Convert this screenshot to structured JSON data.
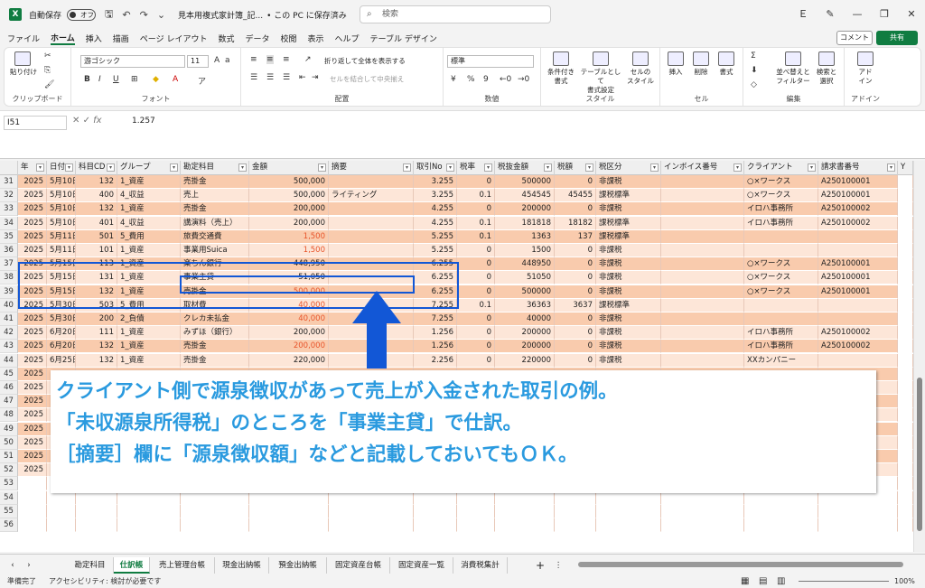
{
  "titlebar": {
    "autosave": "自動保存",
    "toggle": "オフ",
    "filename": "見本用複式家計簿_記...",
    "save_status": "• この PC に保存済み",
    "search_placeholder": "検索",
    "user_initial": "Ｅ"
  },
  "menu": {
    "tabs": [
      "ファイル",
      "ホーム",
      "挿入",
      "描画",
      "ページ レイアウト",
      "数式",
      "データ",
      "校閲",
      "表示",
      "ヘルプ",
      "テーブル デザイン"
    ],
    "active": "ホーム",
    "comment": "コメント",
    "share": "共有"
  },
  "ribbon": {
    "clipboard": {
      "label": "クリップボード",
      "paste": "貼り付け"
    },
    "font": {
      "label": "フォント",
      "name": "游ゴシック",
      "size": "11"
    },
    "align": {
      "label": "配置",
      "wrap": "折り返して全体を表示する",
      "merge": "セルを結合して中央揃え"
    },
    "number": {
      "label": "数値",
      "format": "標準"
    },
    "style": {
      "label": "スタイル",
      "cond": "条件付き\n書式",
      "table": "テーブルとして\n書式設定",
      "cellstyle": "セルの\nスタイル"
    },
    "cells": {
      "label": "セル",
      "insert": "挿入",
      "delete": "削除",
      "format": "書式"
    },
    "edit": {
      "label": "編集",
      "sort": "並べ替えと\nフィルター",
      "find": "検索と\n選択"
    },
    "addin": {
      "label": "アドイン",
      "btn": "アド\nイン"
    }
  },
  "formula": {
    "namebox": "I51",
    "value": "1.257"
  },
  "columns": [
    "年",
    "日付",
    "科目CD",
    "グループ",
    "勘定科目",
    "金額",
    "摘要",
    "取引No",
    "税率",
    "税抜金額",
    "税額",
    "税区分",
    "インボイス番号",
    "クライアント",
    "請求書番号",
    "Y"
  ],
  "rows": [
    {
      "n": "31",
      "y": "2025",
      "d": "5月10日",
      "cd": "132",
      "g": "1_資産",
      "k": "売掛金",
      "a": "500,000",
      "t": "",
      "no": "3.255",
      "tax": "0",
      "ex": "500000",
      "ta": "0",
      "kb": "非課税",
      "cl": "○×ワークス",
      "inv": "A250100001",
      "red": false,
      "band": 1
    },
    {
      "n": "32",
      "y": "2025",
      "d": "5月10日",
      "cd": "400",
      "g": "4_収益",
      "k": "売上",
      "a": "500,000",
      "t": "ライティング",
      "no": "3.255",
      "tax": "0.1",
      "ex": "454545",
      "ta": "45455",
      "kb": "課税標準",
      "cl": "○×ワークス",
      "inv": "A250100001",
      "red": false,
      "band": 2
    },
    {
      "n": "33",
      "y": "2025",
      "d": "5月10日",
      "cd": "132",
      "g": "1_資産",
      "k": "売掛金",
      "a": "200,000",
      "t": "",
      "no": "4.255",
      "tax": "0",
      "ex": "200000",
      "ta": "0",
      "kb": "非課税",
      "cl": "イロハ事務所",
      "inv": "A250100002",
      "red": false,
      "band": 1
    },
    {
      "n": "34",
      "y": "2025",
      "d": "5月10日",
      "cd": "401",
      "g": "4_収益",
      "k": "講演料（売上）",
      "a": "200,000",
      "t": "",
      "no": "4.255",
      "tax": "0.1",
      "ex": "181818",
      "ta": "18182",
      "kb": "課税標準",
      "cl": "イロハ事務所",
      "inv": "A250100002",
      "red": false,
      "band": 2
    },
    {
      "n": "35",
      "y": "2025",
      "d": "5月11日",
      "cd": "501",
      "g": "5_費用",
      "k": "旅費交通費",
      "a": "1,500",
      "t": "",
      "no": "5.255",
      "tax": "0.1",
      "ex": "1363",
      "ta": "137",
      "kb": "課税標準",
      "cl": "",
      "inv": "",
      "red": true,
      "band": 1
    },
    {
      "n": "36",
      "y": "2025",
      "d": "5月11日",
      "cd": "101",
      "g": "1_資産",
      "k": "事業用Suica",
      "a": "1,500",
      "t": "",
      "no": "5.255",
      "tax": "0",
      "ex": "1500",
      "ta": "0",
      "kb": "非課税",
      "cl": "",
      "inv": "",
      "red": true,
      "band": 2
    },
    {
      "n": "37",
      "y": "2025",
      "d": "5月15日",
      "cd": "113",
      "g": "1_資産",
      "k": "楽ちん銀行",
      "a": "448,950",
      "t": "",
      "no": "6.255",
      "tax": "0",
      "ex": "448950",
      "ta": "0",
      "kb": "非課税",
      "cl": "○×ワークス",
      "inv": "A250100001",
      "red": false,
      "band": 1
    },
    {
      "n": "38",
      "y": "2025",
      "d": "5月15日",
      "cd": "131",
      "g": "1_資産",
      "k": "事業主貸",
      "a": "51,050",
      "t": "",
      "no": "6.255",
      "tax": "0",
      "ex": "51050",
      "ta": "0",
      "kb": "非課税",
      "cl": "○×ワークス",
      "inv": "A250100001",
      "red": false,
      "band": 2
    },
    {
      "n": "39",
      "y": "2025",
      "d": "5月15日",
      "cd": "132",
      "g": "1_資産",
      "k": "売掛金",
      "a": "500,000",
      "t": "",
      "no": "6.255",
      "tax": "0",
      "ex": "500000",
      "ta": "0",
      "kb": "非課税",
      "cl": "○×ワークス",
      "inv": "A250100001",
      "red": true,
      "band": 1
    },
    {
      "n": "40",
      "y": "2025",
      "d": "5月30日",
      "cd": "503",
      "g": "5_費用",
      "k": "取材費",
      "a": "40,000",
      "t": "",
      "no": "7.255",
      "tax": "0.1",
      "ex": "36363",
      "ta": "3637",
      "kb": "課税標準",
      "cl": "",
      "inv": "",
      "red": true,
      "band": 2
    },
    {
      "n": "41",
      "y": "2025",
      "d": "5月30日",
      "cd": "200",
      "g": "2_負債",
      "k": "クレカ未払金",
      "a": "40,000",
      "t": "",
      "no": "7.255",
      "tax": "0",
      "ex": "40000",
      "ta": "0",
      "kb": "非課税",
      "cl": "",
      "inv": "",
      "red": true,
      "band": 1
    },
    {
      "n": "42",
      "y": "2025",
      "d": "6月20日",
      "cd": "111",
      "g": "1_資産",
      "k": "みずほ（銀行）",
      "a": "200,000",
      "t": "",
      "no": "1.256",
      "tax": "0",
      "ex": "200000",
      "ta": "0",
      "kb": "非課税",
      "cl": "イロハ事務所",
      "inv": "A250100002",
      "red": false,
      "band": 2
    },
    {
      "n": "43",
      "y": "2025",
      "d": "6月20日",
      "cd": "132",
      "g": "1_資産",
      "k": "売掛金",
      "a": "200,000",
      "t": "",
      "no": "1.256",
      "tax": "0",
      "ex": "200000",
      "ta": "0",
      "kb": "非課税",
      "cl": "イロハ事務所",
      "inv": "A250100002",
      "red": true,
      "band": 1
    },
    {
      "n": "44",
      "y": "2025",
      "d": "6月25日",
      "cd": "132",
      "g": "1_資産",
      "k": "売掛金",
      "a": "220,000",
      "t": "",
      "no": "2.256",
      "tax": "0",
      "ex": "220000",
      "ta": "0",
      "kb": "非課税",
      "cl": "XXカンパニー",
      "inv": "",
      "red": false,
      "band": 2
    },
    {
      "n": "45",
      "y": "2025",
      "d": "",
      "cd": "",
      "g": "",
      "k": "",
      "a": "",
      "t": "",
      "no": "",
      "tax": "",
      "ex": "",
      "ta": "",
      "kb": "",
      "cl": "",
      "inv": "",
      "red": false,
      "band": 1
    },
    {
      "n": "46",
      "y": "2025",
      "d": "",
      "cd": "",
      "g": "",
      "k": "",
      "a": "",
      "t": "",
      "no": "",
      "tax": "",
      "ex": "",
      "ta": "",
      "kb": "",
      "cl": "",
      "inv": "",
      "red": false,
      "band": 2
    },
    {
      "n": "47",
      "y": "2025",
      "d": "",
      "cd": "",
      "g": "",
      "k": "",
      "a": "",
      "t": "",
      "no": "",
      "tax": "",
      "ex": "",
      "ta": "",
      "kb": "",
      "cl": "",
      "inv": "",
      "red": false,
      "band": 1
    },
    {
      "n": "48",
      "y": "2025",
      "d": "",
      "cd": "",
      "g": "",
      "k": "",
      "a": "",
      "t": "",
      "no": "",
      "tax": "",
      "ex": "",
      "ta": "",
      "kb": "",
      "cl": "",
      "inv": "",
      "red": false,
      "band": 2
    },
    {
      "n": "49",
      "y": "2025",
      "d": "",
      "cd": "",
      "g": "",
      "k": "",
      "a": "",
      "t": "",
      "no": "",
      "tax": "",
      "ex": "",
      "ta": "",
      "kb": "",
      "cl": "",
      "inv": "",
      "red": false,
      "band": 1
    },
    {
      "n": "50",
      "y": "2025",
      "d": "",
      "cd": "",
      "g": "",
      "k": "",
      "a": "",
      "t": "",
      "no": "",
      "tax": "",
      "ex": "",
      "ta": "",
      "kb": "",
      "cl": "",
      "inv": "",
      "red": false,
      "band": 2
    },
    {
      "n": "51",
      "y": "2025",
      "d": "",
      "cd": "",
      "g": "",
      "k": "",
      "a": "",
      "t": "",
      "no": "",
      "tax": "",
      "ex": "",
      "ta": "",
      "kb": "",
      "cl": "",
      "inv": "",
      "red": false,
      "band": 1
    },
    {
      "n": "52",
      "y": "2025",
      "d": "",
      "cd": "",
      "g": "",
      "k": "",
      "a": "",
      "t": "",
      "no": "",
      "tax": "",
      "ex": "",
      "ta": "",
      "kb": "",
      "cl": "",
      "inv": "",
      "red": false,
      "band": 2
    },
    {
      "n": "53",
      "y": "",
      "d": "",
      "cd": "",
      "g": "",
      "k": "",
      "a": "",
      "t": "",
      "no": "",
      "tax": "",
      "ex": "",
      "ta": "",
      "kb": "",
      "cl": "",
      "inv": "",
      "red": false,
      "band": 0
    },
    {
      "n": "54",
      "y": "",
      "d": "",
      "cd": "",
      "g": "",
      "k": "",
      "a": "",
      "t": "",
      "no": "",
      "tax": "",
      "ex": "",
      "ta": "",
      "kb": "",
      "cl": "",
      "inv": "",
      "red": false,
      "band": 0
    },
    {
      "n": "55",
      "y": "",
      "d": "",
      "cd": "",
      "g": "",
      "k": "",
      "a": "",
      "t": "",
      "no": "",
      "tax": "",
      "ex": "",
      "ta": "",
      "kb": "",
      "cl": "",
      "inv": "",
      "red": false,
      "band": 0
    },
    {
      "n": "56",
      "y": "",
      "d": "",
      "cd": "",
      "g": "",
      "k": "",
      "a": "",
      "t": "",
      "no": "",
      "tax": "",
      "ex": "",
      "ta": "",
      "kb": "",
      "cl": "",
      "inv": "",
      "red": false,
      "band": 0
    }
  ],
  "callout": {
    "line1": "クライアント側で源泉徴収があって売上が入金された取引の例。",
    "line2": "「未収源泉所得税」のところを「事業主貸」で仕訳。",
    "line3": "［摘要］欄に「源泉徴収額」などと記載しておいてもＯＫ。"
  },
  "sheets": {
    "tabs": [
      "勘定科目",
      "仕訳帳",
      "売上管理台帳",
      "現金出納帳",
      "預金出納帳",
      "固定資産台帳",
      "固定資産一覧",
      "消費税集計"
    ],
    "active": "仕訳帳"
  },
  "status": {
    "ready": "準備完了",
    "accessibility": "アクセシビリティ: 検討が必要です",
    "zoom": "100%"
  }
}
